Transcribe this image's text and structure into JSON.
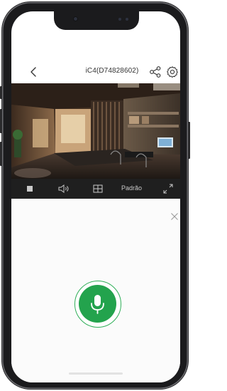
{
  "header": {
    "title": "iC4(D74828602)",
    "back_icon": "chevron-left-icon",
    "share_icon": "share-icon",
    "settings_icon": "gear-icon"
  },
  "video": {
    "description_icon": "live-camera-feed"
  },
  "toolbar": {
    "stop_icon": "stop-icon",
    "audio_icon": "speaker-icon",
    "layout_icon": "grid-icon",
    "quality_label": "Padrão",
    "fullscreen_icon": "fullscreen-icon"
  },
  "talk_panel": {
    "close_icon": "close-icon",
    "mic_icon": "microphone-icon"
  },
  "colors": {
    "accent_green": "#23a34d",
    "toolbar_bg": "#1f1f1f",
    "panel_bg": "#fbfbfb"
  }
}
